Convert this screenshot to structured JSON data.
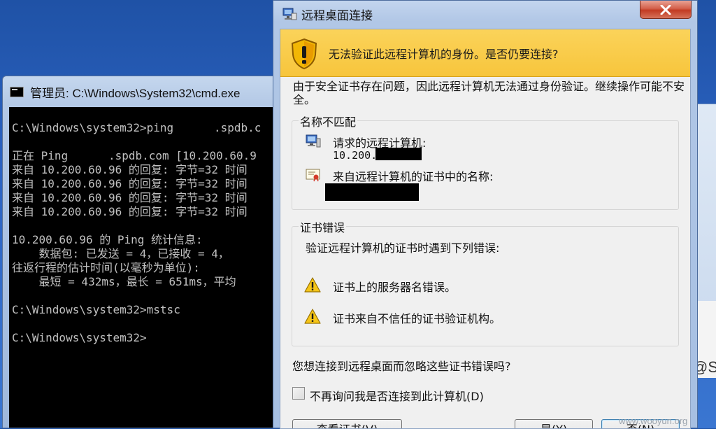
{
  "cmd_window": {
    "title": "管理员: C:\\Windows\\System32\\cmd.exe",
    "lines": [
      "C:\\Windows\\system32>ping      .spdb.c",
      "",
      "正在 Ping      .spdb.com [10.200.60.9",
      "来自 10.200.60.96 的回复: 字节=32 时间",
      "来自 10.200.60.96 的回复: 字节=32 时间",
      "来自 10.200.60.96 的回复: 字节=32 时间",
      "来自 10.200.60.96 的回复: 字节=32 时间",
      "",
      "10.200.60.96 的 Ping 统计信息:",
      "    数据包: 已发送 = 4，已接收 = 4，",
      "往返行程的估计时间(以毫秒为单位):",
      "    最短 = 432ms，最长 = 651ms，平均",
      "",
      "C:\\Windows\\system32>mstsc",
      "",
      "C:\\Windows\\system32>"
    ]
  },
  "dialog": {
    "title": "远程桌面连接",
    "close_label": "X",
    "warning_header": "无法验证此远程计算机的身份。是否仍要连接?",
    "intro_text": "由于安全证书存在问题，因此远程计算机无法通过身份验证。继续操作可能不安全。",
    "name_mismatch": {
      "label": "名称不匹配",
      "requested_label": "请求的远程计算机:",
      "requested_value": "10.200.",
      "cert_name_label": "来自远程计算机的证书中的名称:"
    },
    "cert_errors": {
      "label": "证书错误",
      "intro": "验证远程计算机的证书时遇到下列错误:",
      "errors": [
        "证书上的服务器名错误。",
        "证书来自不信任的证书验证机构。"
      ]
    },
    "question": "您想连接到远程桌面而忽略这些证书错误吗?",
    "dont_ask_label": "不再询问我是否连接到此计算机(D)",
    "dont_ask_checked": false,
    "buttons": {
      "view_cert": "查看证书(V)",
      "yes": "是(Y)",
      "no": "否(N)"
    }
  },
  "background_window": {
    "partial_text": "@S"
  },
  "watermark": "www.wooyun.org",
  "colors": {
    "warning_band": "#f7c53c",
    "console_bg": "#000000",
    "console_fg": "#c0c0c0",
    "desktop": "#2c63c2"
  }
}
